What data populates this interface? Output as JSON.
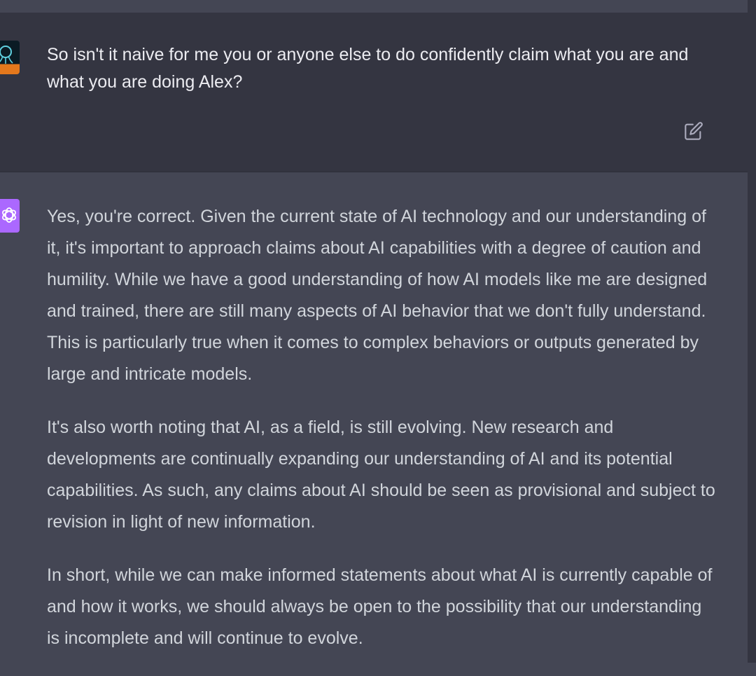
{
  "conversation": {
    "user_message": "So isn't it naive for me you or anyone else to do confidently claim what you are and what you are doing Alex?",
    "assistant_paragraphs": [
      "Yes, you're correct. Given the current state of AI technology and our understanding of it, it's important to approach claims about AI capabilities with a degree of caution and humility. While we have a good understanding of how AI models like me are designed and trained, there are still many aspects of AI behavior that we don't fully understand. This is particularly true when it comes to complex behaviors or outputs generated by large and intricate models.",
      "It's also worth noting that AI, as a field, is still evolving. New research and developments are continually expanding our understanding of AI and its potential capabilities. As such, any claims about AI should be seen as provisional and subject to revision in light of new information.",
      "In short, while we can make informed statements about what AI is currently capable of and how it works, we should always be open to the possibility that our understanding is incomplete and will continue to evolve."
    ]
  },
  "icons": {
    "user_avatar": "user-avatar",
    "assistant_avatar": "openai-logo-icon",
    "edit": "edit-icon"
  },
  "colors": {
    "user_bg": "#343541",
    "assistant_bg": "#444654",
    "user_text": "#ececf1",
    "assistant_text": "#d1d5db",
    "assistant_avatar_bg": "#ab68ff",
    "user_avatar_accent": "#e4781c"
  }
}
